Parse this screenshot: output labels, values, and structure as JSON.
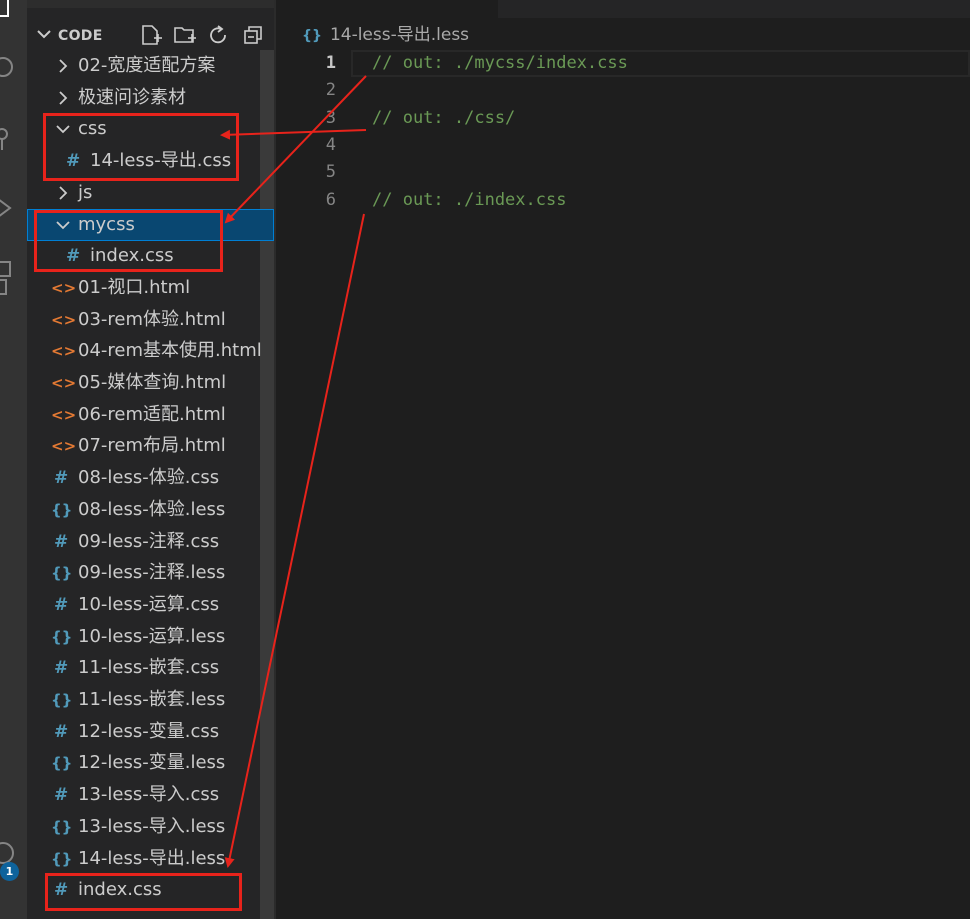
{
  "explorer": {
    "title": "CODE"
  },
  "tree": [
    {
      "label": "02-宽度适配方案",
      "kind": "folder",
      "expanded": false,
      "depth": 0
    },
    {
      "label": "极速问诊素材",
      "kind": "folder",
      "expanded": false,
      "depth": 0
    },
    {
      "label": "css",
      "kind": "folder",
      "expanded": true,
      "depth": 0
    },
    {
      "label": "14-less-导出.css",
      "kind": "css",
      "depth": 1
    },
    {
      "label": "js",
      "kind": "folder",
      "expanded": false,
      "depth": 0
    },
    {
      "label": "mycss",
      "kind": "folder",
      "expanded": true,
      "depth": 0,
      "selected": true
    },
    {
      "label": "index.css",
      "kind": "css",
      "depth": 1
    },
    {
      "label": "01-视口.html",
      "kind": "html",
      "depth": 0
    },
    {
      "label": "03-rem体验.html",
      "kind": "html",
      "depth": 0
    },
    {
      "label": "04-rem基本使用.html",
      "kind": "html",
      "depth": 0
    },
    {
      "label": "05-媒体查询.html",
      "kind": "html",
      "depth": 0
    },
    {
      "label": "06-rem适配.html",
      "kind": "html",
      "depth": 0
    },
    {
      "label": "07-rem布局.html",
      "kind": "html",
      "depth": 0
    },
    {
      "label": "08-less-体验.css",
      "kind": "css",
      "depth": 0
    },
    {
      "label": "08-less-体验.less",
      "kind": "less",
      "depth": 0
    },
    {
      "label": "09-less-注释.css",
      "kind": "css",
      "depth": 0
    },
    {
      "label": "09-less-注释.less",
      "kind": "less",
      "depth": 0
    },
    {
      "label": "10-less-运算.css",
      "kind": "css",
      "depth": 0
    },
    {
      "label": "10-less-运算.less",
      "kind": "less",
      "depth": 0
    },
    {
      "label": "11-less-嵌套.css",
      "kind": "css",
      "depth": 0
    },
    {
      "label": "11-less-嵌套.less",
      "kind": "less",
      "depth": 0
    },
    {
      "label": "12-less-变量.css",
      "kind": "css",
      "depth": 0
    },
    {
      "label": "12-less-变量.less",
      "kind": "less",
      "depth": 0
    },
    {
      "label": "13-less-导入.css",
      "kind": "css",
      "depth": 0
    },
    {
      "label": "13-less-导入.less",
      "kind": "less",
      "depth": 0
    },
    {
      "label": "14-less-导出.less",
      "kind": "less",
      "depth": 0
    },
    {
      "label": "index.css",
      "kind": "css",
      "depth": 0
    }
  ],
  "editor": {
    "breadcrumb_icon": "{}",
    "breadcrumb_file": "14-less-导出.less",
    "line_numbers": [
      "1",
      "2",
      "3",
      "4",
      "5",
      "6"
    ],
    "lines": [
      "// out: ./mycss/index.css",
      "",
      "// out: ./css/",
      "",
      "",
      "// out: ./index.css"
    ],
    "active_line": 1
  },
  "activity": {
    "badge": "1",
    "icons": [
      "explorer-icon",
      "search-icon",
      "source-control-icon",
      "run-debug-icon",
      "extensions-icon",
      "account-icon"
    ]
  },
  "colors": {
    "annotation_red": "#e8231b",
    "comment_green": "#6a9955",
    "selection_blue": "#094771",
    "css_icon": "#519aba",
    "html_icon": "#e37933"
  },
  "icons": {
    "css": "#",
    "less": "{}",
    "html": "<>"
  }
}
